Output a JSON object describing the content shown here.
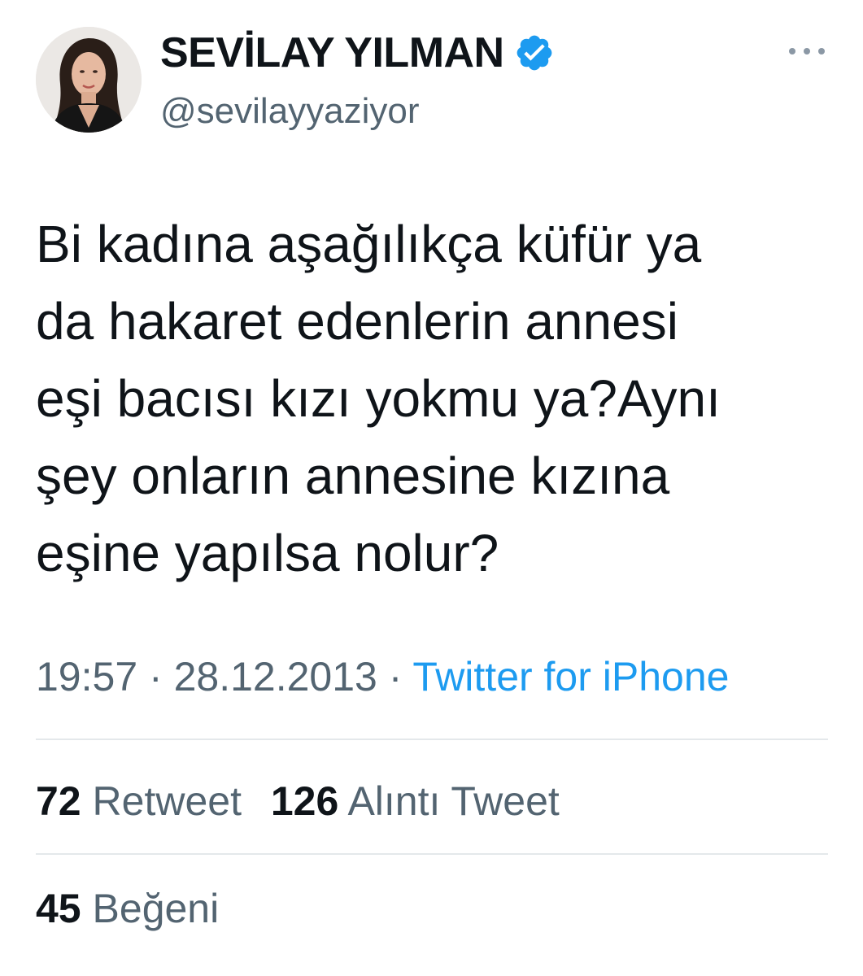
{
  "author": {
    "display_name": "SEVİLAY YILMAN",
    "handle": "@sevilayyaziyor",
    "verified": true,
    "verified_color": "#1d9bf0",
    "avatar_icon": "profile-photo"
  },
  "tweet": {
    "text": "Bi kadına aşağılıkça küfür ya\nda hakaret edenlerin annesi\neşi bacısı kızı yokmu ya?Aynı\nşey onların annesine kızına\neşine yapılsa nolur?",
    "time": "19:57",
    "separator": "·",
    "date": "28.12.2013",
    "source": "Twitter for iPhone"
  },
  "stats": {
    "retweets_count": "72",
    "retweets_label": "Retweet",
    "quotes_count": "126",
    "quotes_label": "Alıntı Tweet",
    "likes_count": "45",
    "likes_label": "Beğeni"
  },
  "colors": {
    "text": "#0f1419",
    "secondary": "#536471",
    "link": "#1d9bf0",
    "divider": "#e4e8eb"
  }
}
